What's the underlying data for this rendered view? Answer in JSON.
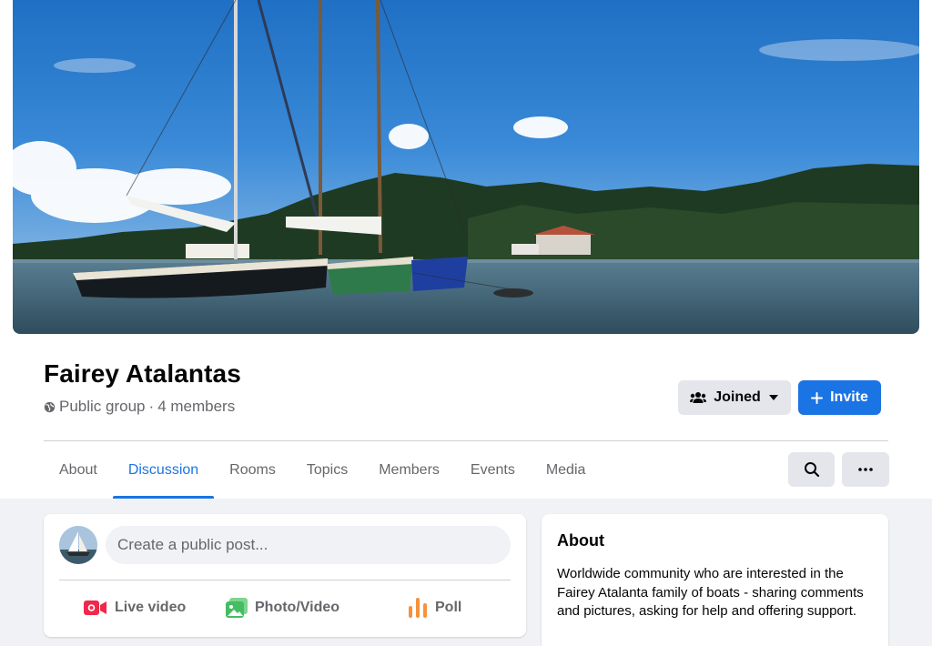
{
  "group": {
    "name": "Fairey Atalantas",
    "privacy": "Public group",
    "separator": "·",
    "members": "4 members"
  },
  "actions": {
    "joined_label": "Joined",
    "invite_label": "Invite"
  },
  "tabs": [
    {
      "label": "About"
    },
    {
      "label": "Discussion",
      "active": true
    },
    {
      "label": "Rooms"
    },
    {
      "label": "Topics"
    },
    {
      "label": "Members"
    },
    {
      "label": "Events"
    },
    {
      "label": "Media"
    }
  ],
  "composer": {
    "placeholder": "Create a public post...",
    "live_video": "Live video",
    "photo_video": "Photo/Video",
    "poll": "Poll"
  },
  "about_card": {
    "title": "About",
    "description": "Worldwide community who are interested in the Fairey Atalanta family of boats - sharing comments and pictures, asking for help and offering support."
  },
  "colors": {
    "accent": "#1b74e4",
    "live_red": "#f02849",
    "photo_green": "#45bd62",
    "poll_orange": "#f7923b"
  },
  "icons": [
    "globe-icon",
    "joined-group-icon",
    "caret-down-icon",
    "plus-icon",
    "search-icon",
    "more-icon",
    "live-video-icon",
    "photo-icon",
    "poll-icon"
  ]
}
